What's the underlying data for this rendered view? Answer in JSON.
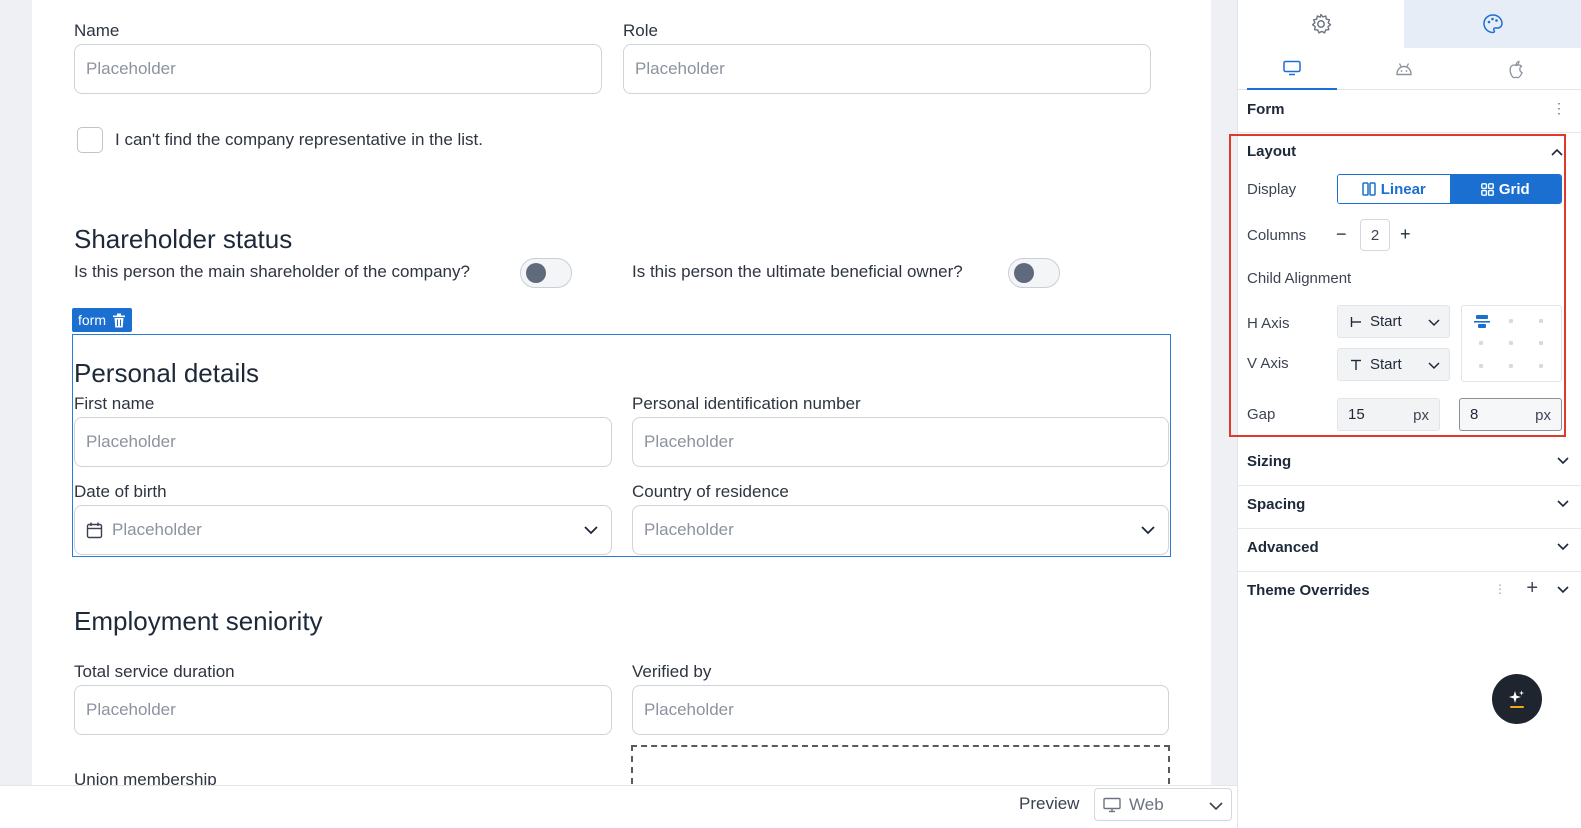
{
  "form_top": {
    "name_label": "Name",
    "name_placeholder": "Placeholder",
    "role_label": "Role",
    "role_placeholder": "Placeholder",
    "checkbox_label": "I can't find the company representative in the list."
  },
  "shareholder": {
    "heading": "Shareholder status",
    "q1": "Is this person the main shareholder of the company?",
    "q2": "Is this person the ultimate beneficial owner?"
  },
  "form_tag": {
    "label": "form",
    "icon": "trash-icon"
  },
  "personal": {
    "heading": "Personal details",
    "first_name_label": "First name",
    "first_name_placeholder": "Placeholder",
    "pin_label": "Personal identification number",
    "pin_placeholder": "Placeholder",
    "dob_label": "Date of birth",
    "dob_placeholder": "Placeholder",
    "country_label": "Country of residence",
    "country_placeholder": "Placeholder"
  },
  "employment": {
    "heading": "Employment seniority",
    "duration_label": "Total service duration",
    "duration_placeholder": "Placeholder",
    "verified_label": "Verified by",
    "verified_placeholder": "Placeholder",
    "union_label": "Union membership"
  },
  "bottom": {
    "preview_label": "Preview",
    "platform_value": "Web"
  },
  "panel": {
    "top_tabs": [
      {
        "icon": "gear-icon"
      },
      {
        "icon": "palette-icon",
        "active": true
      }
    ],
    "device_tabs": [
      {
        "icon": "desktop-icon",
        "active": true
      },
      {
        "icon": "android-icon"
      },
      {
        "icon": "apple-icon"
      }
    ],
    "form_title": "Form",
    "layout": {
      "title": "Layout",
      "display_label": "Display",
      "display_options": [
        "Linear",
        "Grid"
      ],
      "display_selected": "Grid",
      "columns_label": "Columns",
      "columns_value": "2",
      "minus": "−",
      "plus": "+",
      "child_alignment_label": "Child Alignment",
      "h_axis_label": "H Axis",
      "h_axis_value": "Start",
      "v_axis_label": "V Axis",
      "v_axis_value": "Start",
      "gap_label": "Gap",
      "gap_h": "15",
      "gap_v": "8",
      "unit": "px"
    },
    "sections": [
      "Sizing",
      "Spacing",
      "Advanced",
      "Theme Overrides"
    ],
    "accent": "#1a6fd1",
    "highlight": "#e0392b"
  }
}
